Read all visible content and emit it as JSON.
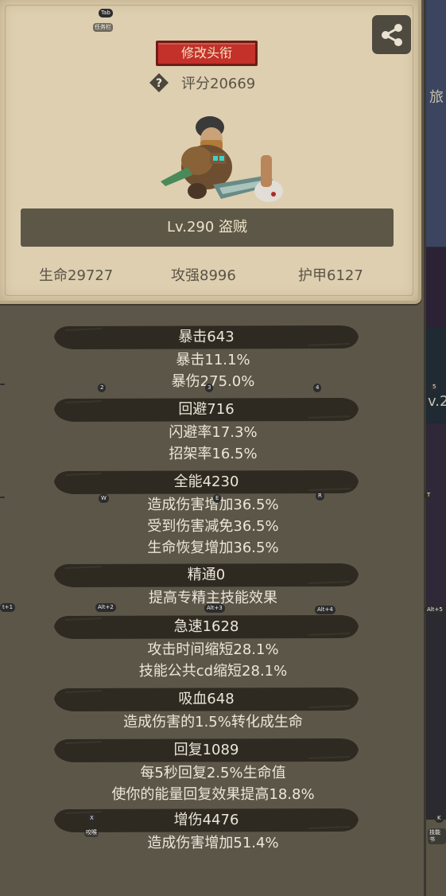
{
  "profile": {
    "edit_title_button": "修改头衔",
    "score": "评分20669",
    "level_class": "Lv.290 盗贼",
    "hp": "生命29727",
    "attack_power": "攻强8996",
    "armor": "护甲6127"
  },
  "hotkeys": {
    "tab": "Tab",
    "tab_sub": "任务栏",
    "k2": "2",
    "k3": "3",
    "k4": "4",
    "k5": "5",
    "kw": "W",
    "ke": "E",
    "kr": "R",
    "kt": "T",
    "alt1": "t+1",
    "alt2": "Alt+2",
    "alt3": "Alt+3",
    "alt4": "Alt+4",
    "alt5": "Alt+5",
    "kx": "X",
    "kx_sub": "咬喉",
    "kk": "K",
    "kk_sub": "技能书"
  },
  "background": {
    "right_text1": "旅",
    "right_text2": "v.2"
  },
  "stats": [
    {
      "header": "暴击643",
      "lines": [
        "暴击11.1%",
        "暴伤275.0%"
      ]
    },
    {
      "header": "回避716",
      "lines": [
        "闪避率17.3%",
        "招架率16.5%"
      ]
    },
    {
      "header": "全能4230",
      "lines": [
        "造成伤害增加36.5%",
        "受到伤害减免36.5%",
        "生命恢复增加36.5%"
      ]
    },
    {
      "header": "精通0",
      "lines": [
        "提高专精主技能效果"
      ]
    },
    {
      "header": "急速1628",
      "lines": [
        "攻击时间缩短28.1%",
        "技能公共cd缩短28.1%"
      ]
    },
    {
      "header": "吸血648",
      "lines": [
        "造成伤害的1.5%转化成生命"
      ]
    },
    {
      "header": "回复1089",
      "lines": [
        "每5秒回复2.5%生命值",
        "使你的能量回复效果提高18.8%"
      ]
    },
    {
      "header": "增伤4476",
      "lines": [
        "造成伤害增加51.4%"
      ]
    }
  ],
  "colors": {
    "panel_bg": "#5c5649",
    "parchment": "#ddcfb0",
    "button_red": "#c4302a",
    "header_bar": "#2e2a22",
    "text_light": "#ece6d8"
  }
}
